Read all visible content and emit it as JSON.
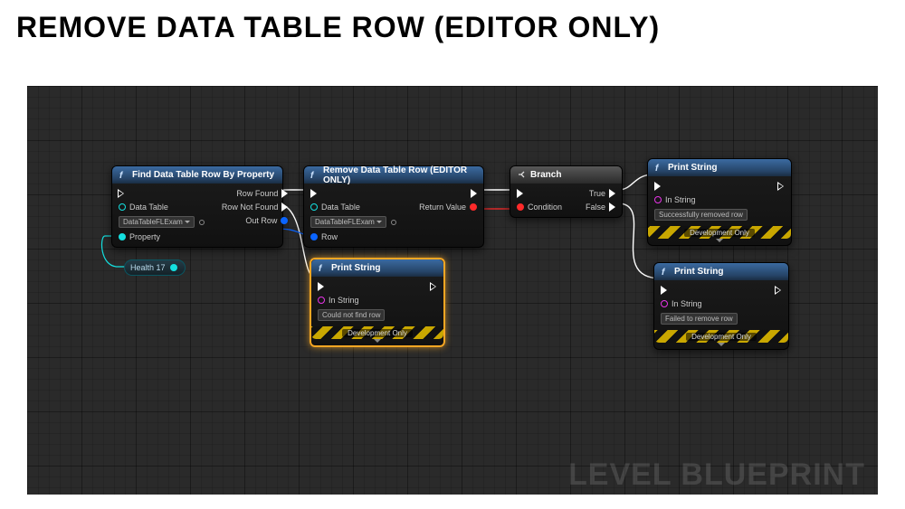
{
  "title": "REMOVE DATA TABLE ROW (EDITOR ONLY)",
  "watermark": "LEVEL BLUEPRINT",
  "nodes": {
    "find": {
      "title": "Find Data Table Row By Property",
      "dataTableLabel": "Data Table",
      "dataTableValue": "DataTableFLExam",
      "propertyLabel": "Property",
      "rowFound": "Row Found",
      "rowNotFound": "Row Not Found",
      "outRow": "Out Row"
    },
    "remove": {
      "title": "Remove Data Table Row (EDITOR ONLY)",
      "dataTableLabel": "Data Table",
      "dataTableValue": "DataTableFLExam",
      "rowLabel": "Row",
      "returnValue": "Return Value"
    },
    "branch": {
      "title": "Branch",
      "condition": "Condition",
      "trueLabel": "True",
      "falseLabel": "False"
    },
    "printCouldNot": {
      "title": "Print String",
      "inStringLabel": "In String",
      "inStringValue": "Could not find row",
      "devOnly": "Development Only"
    },
    "printSuccess": {
      "title": "Print String",
      "inStringLabel": "In String",
      "inStringValue": "Successfully removed row",
      "devOnly": "Development Only"
    },
    "printFailed": {
      "title": "Print String",
      "inStringLabel": "In String",
      "inStringValue": "Failed to remove row",
      "devOnly": "Development Only"
    }
  },
  "variable": {
    "name": "Health 17"
  }
}
